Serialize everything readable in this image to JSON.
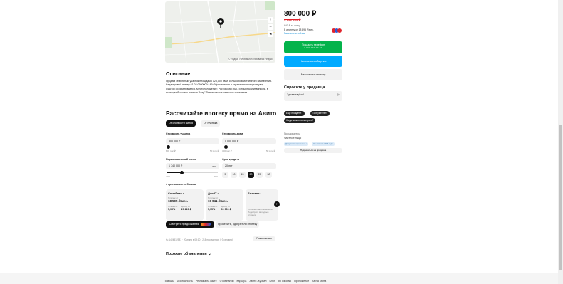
{
  "map": {
    "copyright": "© Яндекс Условия использования Яндекс",
    "zoom_in": "+",
    "zoom_out": "−",
    "locate": "◂"
  },
  "description": {
    "title": "Описание",
    "text": "Продам земельный участок площадью 125,000 кв/м, сельскохозяйственного назначения. Кадастровый номер 61:04:0600009:149 Обременения и ограничения отсутствуют, участок обрабатывается. Местоположение: Ростовская обл., р-н Белокалитвинский, в границах бывшего колхоза \"Мир\" Литвиновское сельское поселение."
  },
  "mortgage": {
    "title": "Рассчитайте ипотеку прямо на Авито",
    "toggle_cost": "От стоимости жилья",
    "toggle_payment": "От платежа",
    "land_label": "Стоимость участка",
    "land_value": "800 000 ₽",
    "land_min": "800 тыс ₽",
    "land_max": "50 млн ₽",
    "house_label": "Стоимость дома",
    "house_value": "5 000 000 ₽",
    "house_min": "300 тыс ₽",
    "house_max": "50 млн ₽",
    "down_label": "Первоначальный взнос",
    "down_value": "1 740 000 ₽",
    "down_pct": "30%",
    "down_min": "20%",
    "down_max": "90%",
    "term_label": "Срок кредита",
    "term_value": "20 лет",
    "terms": [
      "5",
      "10",
      "15",
      "20",
      "25",
      "30"
    ],
    "active_term": "20",
    "programs_label": "4 программы от банков",
    "cards": [
      {
        "name": "Семейная ›",
        "cl": "Платеж от",
        "cv": "18 595 ₽/мес.",
        "r1l": "Ставка от",
        "r1v": "5,95%",
        "r2l": "Доход от",
        "r2v": "29 226 ₽"
      },
      {
        "name": "Для IT ›",
        "cl": "Платеж от",
        "cv": "19 041 ₽/мес.",
        "r1l": "Ставка от",
        "r1v": "5,95%",
        "r2l": "Доход от",
        "r2v": "90 000 ₽"
      },
      {
        "name": "Базовая ›",
        "cl": "",
        "cv": "",
        "r1l": "Покажем как сэкономить",
        "r1v": "",
        "r2l": "Подобрать выгодные условия",
        "r2v": ""
      }
    ],
    "offers_btn": "Смотреть предложения",
    "check_btn": "Проверить, одобрят ли ипотеку"
  },
  "meta": {
    "text": "№ 1424312581 · 20 июня в 09:10 · 218 просмотров (+3 сегодня)",
    "complain": "Пожаловаться"
  },
  "similar": "Похожие объявления ⌄",
  "seller": {
    "price": "800 000 ₽",
    "old_price": "1 050 000 ₽",
    "per_sotka": "640 ₽ за сотку",
    "installment": "В ипотеку от 18 595 ₽/мес.",
    "installment_link": "Рассчитать сейчас",
    "show_phone": "Показать телефон",
    "phone_mask": "8 XXX XXX-XX-XX",
    "write": "Написать сообщение",
    "calc": "Рассчитать ипотеку",
    "ask_title": "Спросите у продавца",
    "ask_placeholder": "Здравствуйте!",
    "q1": "Ещё продаёте?",
    "q2": "Торг уместен?",
    "q3": "Когда можно посмотреть?",
    "seller_type": "Пользователь",
    "seller_name": "Частное лицо",
    "tag1": "Документы проверены",
    "tag2": "На Авито с 2014 года",
    "subscribe": "Подписаться на продавца"
  },
  "footer": [
    "Помощь",
    "Безопасность",
    "Реклама на сайте",
    "О компании",
    "Карьера",
    "Авито Журнал",
    "Блог",
    "#яПомогаю",
    "Приложение",
    "Карта сайта"
  ],
  "colors": {
    "green": "#04b34b",
    "blue": "#00aaff",
    "red": "#e0232c",
    "dark": "#111111"
  }
}
